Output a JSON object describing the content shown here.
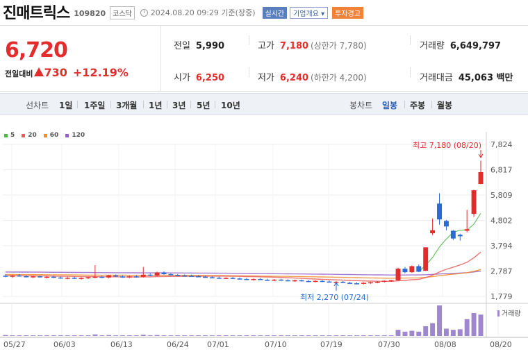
{
  "header": {
    "stock_name": "진매트릭스",
    "stock_code": "109820",
    "market_badge": "코스닥",
    "datetime": "2024.08.20 09:29 기준(장중)",
    "realtime_button": "실시간",
    "overview_button": "기업개요 ▾",
    "warning_badge": "투자경고"
  },
  "quote": {
    "current_price": "6,720",
    "change_label": "전일대비",
    "change_amount": "730",
    "change_percent": "+12.19%",
    "prev_close_label": "전일",
    "prev_close": "5,990",
    "high_label": "고가",
    "high": "7,180",
    "upper_limit": "(상한가 7,780)",
    "volume_label": "거래량",
    "volume": "6,649,797",
    "open_label": "시가",
    "open": "6,250",
    "low_label": "저가",
    "low": "6,240",
    "lower_limit": "(하한가 4,200)",
    "value_label": "거래대금",
    "value": "45,063 백만"
  },
  "period_bar": {
    "line_chart_label": "선차트",
    "periods": [
      "1일",
      "1주일",
      "3개월",
      "1년",
      "3년",
      "5년",
      "10년"
    ],
    "candle_chart_label": "봉차트",
    "candle_periods": [
      "일봉",
      "주봉",
      "월봉"
    ],
    "active_candle": "일봉"
  },
  "colors": {
    "up": "#e32d2d",
    "down": "#2b6ad3",
    "ma5": "#4fb748",
    "ma20": "#e85c5c",
    "ma60": "#f08c2e",
    "ma120": "#9461c9",
    "volume": "#9f87cf"
  },
  "chart_data": {
    "type": "candlestick",
    "legend": [
      {
        "name": "5",
        "color": "#4fb748"
      },
      {
        "name": "20",
        "color": "#e85c5c"
      },
      {
        "name": "60",
        "color": "#f08c2e"
      },
      {
        "name": "120",
        "color": "#9461c9"
      }
    ],
    "y_ticks": [
      "7,824",
      "6,817",
      "5,809",
      "4,802",
      "3,794",
      "2,787",
      "1,779"
    ],
    "ylim": [
      1779,
      7824
    ],
    "x_ticks": [
      "05/27",
      "06/03",
      "06/13",
      "06/24",
      "07/01",
      "07/10",
      "07/19",
      "07/30",
      "08/08",
      "08/20"
    ],
    "high_annotation": "최고 7,180 (08/20)",
    "low_annotation": "최저 2,270 (07/24)",
    "volume_label": "거래량",
    "candles": [
      {
        "o": 2600,
        "h": 2660,
        "l": 2540,
        "c": 2560
      },
      {
        "o": 2560,
        "h": 2640,
        "l": 2520,
        "c": 2610
      },
      {
        "o": 2610,
        "h": 2660,
        "l": 2560,
        "c": 2580
      },
      {
        "o": 2580,
        "h": 2620,
        "l": 2530,
        "c": 2555
      },
      {
        "o": 2555,
        "h": 2600,
        "l": 2510,
        "c": 2575
      },
      {
        "o": 2575,
        "h": 2610,
        "l": 2530,
        "c": 2545
      },
      {
        "o": 2545,
        "h": 2590,
        "l": 2500,
        "c": 2560
      },
      {
        "o": 2560,
        "h": 2600,
        "l": 2510,
        "c": 2530
      },
      {
        "o": 2530,
        "h": 2570,
        "l": 2480,
        "c": 2500
      },
      {
        "o": 2500,
        "h": 2550,
        "l": 2460,
        "c": 2520
      },
      {
        "o": 2520,
        "h": 2560,
        "l": 2470,
        "c": 2490
      },
      {
        "o": 2490,
        "h": 2540,
        "l": 2450,
        "c": 2510
      },
      {
        "o": 2510,
        "h": 2560,
        "l": 2470,
        "c": 2540
      },
      {
        "o": 2540,
        "h": 3020,
        "l": 2500,
        "c": 2560
      },
      {
        "o": 2560,
        "h": 2600,
        "l": 2510,
        "c": 2530
      },
      {
        "o": 2530,
        "h": 2640,
        "l": 2500,
        "c": 2610
      },
      {
        "o": 2610,
        "h": 2650,
        "l": 2550,
        "c": 2570
      },
      {
        "o": 2570,
        "h": 2610,
        "l": 2520,
        "c": 2545
      },
      {
        "o": 2545,
        "h": 2600,
        "l": 2510,
        "c": 2575
      },
      {
        "o": 2575,
        "h": 2620,
        "l": 2530,
        "c": 2560
      },
      {
        "o": 2560,
        "h": 2950,
        "l": 2530,
        "c": 2640
      },
      {
        "o": 2640,
        "h": 2700,
        "l": 2580,
        "c": 2600
      },
      {
        "o": 2600,
        "h": 2760,
        "l": 2580,
        "c": 2730
      },
      {
        "o": 2730,
        "h": 2770,
        "l": 2640,
        "c": 2660
      },
      {
        "o": 2660,
        "h": 2700,
        "l": 2610,
        "c": 2630
      },
      {
        "o": 2630,
        "h": 2670,
        "l": 2590,
        "c": 2610
      },
      {
        "o": 2610,
        "h": 2650,
        "l": 2570,
        "c": 2595
      },
      {
        "o": 2595,
        "h": 2640,
        "l": 2560,
        "c": 2580
      },
      {
        "o": 2580,
        "h": 2620,
        "l": 2540,
        "c": 2560
      },
      {
        "o": 2560,
        "h": 2600,
        "l": 2520,
        "c": 2540
      },
      {
        "o": 2540,
        "h": 2580,
        "l": 2500,
        "c": 2520
      },
      {
        "o": 2520,
        "h": 2560,
        "l": 2480,
        "c": 2500
      },
      {
        "o": 2500,
        "h": 2540,
        "l": 2470,
        "c": 2515
      },
      {
        "o": 2515,
        "h": 2550,
        "l": 2470,
        "c": 2490
      },
      {
        "o": 2490,
        "h": 2530,
        "l": 2450,
        "c": 2470
      },
      {
        "o": 2470,
        "h": 2510,
        "l": 2430,
        "c": 2450
      },
      {
        "o": 2450,
        "h": 2490,
        "l": 2410,
        "c": 2470
      },
      {
        "o": 2470,
        "h": 2510,
        "l": 2430,
        "c": 2440
      },
      {
        "o": 2440,
        "h": 2480,
        "l": 2400,
        "c": 2425
      },
      {
        "o": 2425,
        "h": 2470,
        "l": 2390,
        "c": 2445
      },
      {
        "o": 2445,
        "h": 2480,
        "l": 2400,
        "c": 2420
      },
      {
        "o": 2420,
        "h": 2460,
        "l": 2380,
        "c": 2400
      },
      {
        "o": 2400,
        "h": 2440,
        "l": 2360,
        "c": 2420
      },
      {
        "o": 2420,
        "h": 2450,
        "l": 2370,
        "c": 2390
      },
      {
        "o": 2390,
        "h": 2430,
        "l": 2350,
        "c": 2375
      },
      {
        "o": 2375,
        "h": 2420,
        "l": 2340,
        "c": 2395
      },
      {
        "o": 2395,
        "h": 2430,
        "l": 2350,
        "c": 2370
      },
      {
        "o": 2370,
        "h": 2410,
        "l": 2330,
        "c": 2345
      },
      {
        "o": 2345,
        "h": 2390,
        "l": 2310,
        "c": 2360
      },
      {
        "o": 2360,
        "h": 2390,
        "l": 2300,
        "c": 2320
      },
      {
        "o": 2320,
        "h": 2360,
        "l": 2280,
        "c": 2300
      },
      {
        "o": 2300,
        "h": 2340,
        "l": 2270,
        "c": 2290
      },
      {
        "o": 2290,
        "h": 2340,
        "l": 2260,
        "c": 2320
      },
      {
        "o": 2320,
        "h": 2360,
        "l": 2280,
        "c": 2340
      },
      {
        "o": 2340,
        "h": 2380,
        "l": 2300,
        "c": 2360
      },
      {
        "o": 2360,
        "h": 2420,
        "l": 2330,
        "c": 2400
      },
      {
        "o": 2400,
        "h": 2440,
        "l": 2360,
        "c": 2420
      },
      {
        "o": 2420,
        "h": 2920,
        "l": 2400,
        "c": 2880
      },
      {
        "o": 2880,
        "h": 2950,
        "l": 2700,
        "c": 2740
      },
      {
        "o": 2740,
        "h": 3010,
        "l": 2720,
        "c": 2980
      },
      {
        "o": 2980,
        "h": 3050,
        "l": 2740,
        "c": 2760
      },
      {
        "o": 2800,
        "h": 3730,
        "l": 2790,
        "c": 3730
      },
      {
        "o": 4290,
        "h": 4880,
        "l": 4220,
        "c": 4410
      },
      {
        "o": 5470,
        "h": 5880,
        "l": 4630,
        "c": 4840
      },
      {
        "o": 4780,
        "h": 4820,
        "l": 4410,
        "c": 4560
      },
      {
        "o": 4390,
        "h": 4420,
        "l": 4020,
        "c": 4080
      },
      {
        "o": 4230,
        "h": 4270,
        "l": 4000,
        "c": 4170
      },
      {
        "o": 4390,
        "h": 5220,
        "l": 4330,
        "c": 4450
      },
      {
        "o": 5060,
        "h": 6020,
        "l": 4940,
        "c": 6000
      },
      {
        "o": 6250,
        "h": 7180,
        "l": 6240,
        "c": 6720
      }
    ],
    "volumes": [
      3,
      2,
      2,
      2,
      2,
      2,
      2,
      2,
      2,
      2,
      2,
      2,
      2,
      5,
      2,
      3,
      2,
      2,
      2,
      2,
      4,
      2,
      3,
      2,
      2,
      2,
      2,
      2,
      2,
      2,
      2,
      2,
      2,
      2,
      2,
      2,
      2,
      2,
      2,
      2,
      2,
      2,
      2,
      2,
      2,
      2,
      2,
      2,
      2,
      2,
      2,
      2,
      2,
      2,
      2,
      2,
      2,
      20,
      14,
      17,
      14,
      32,
      42,
      100,
      24,
      20,
      22,
      55,
      75,
      70
    ]
  }
}
